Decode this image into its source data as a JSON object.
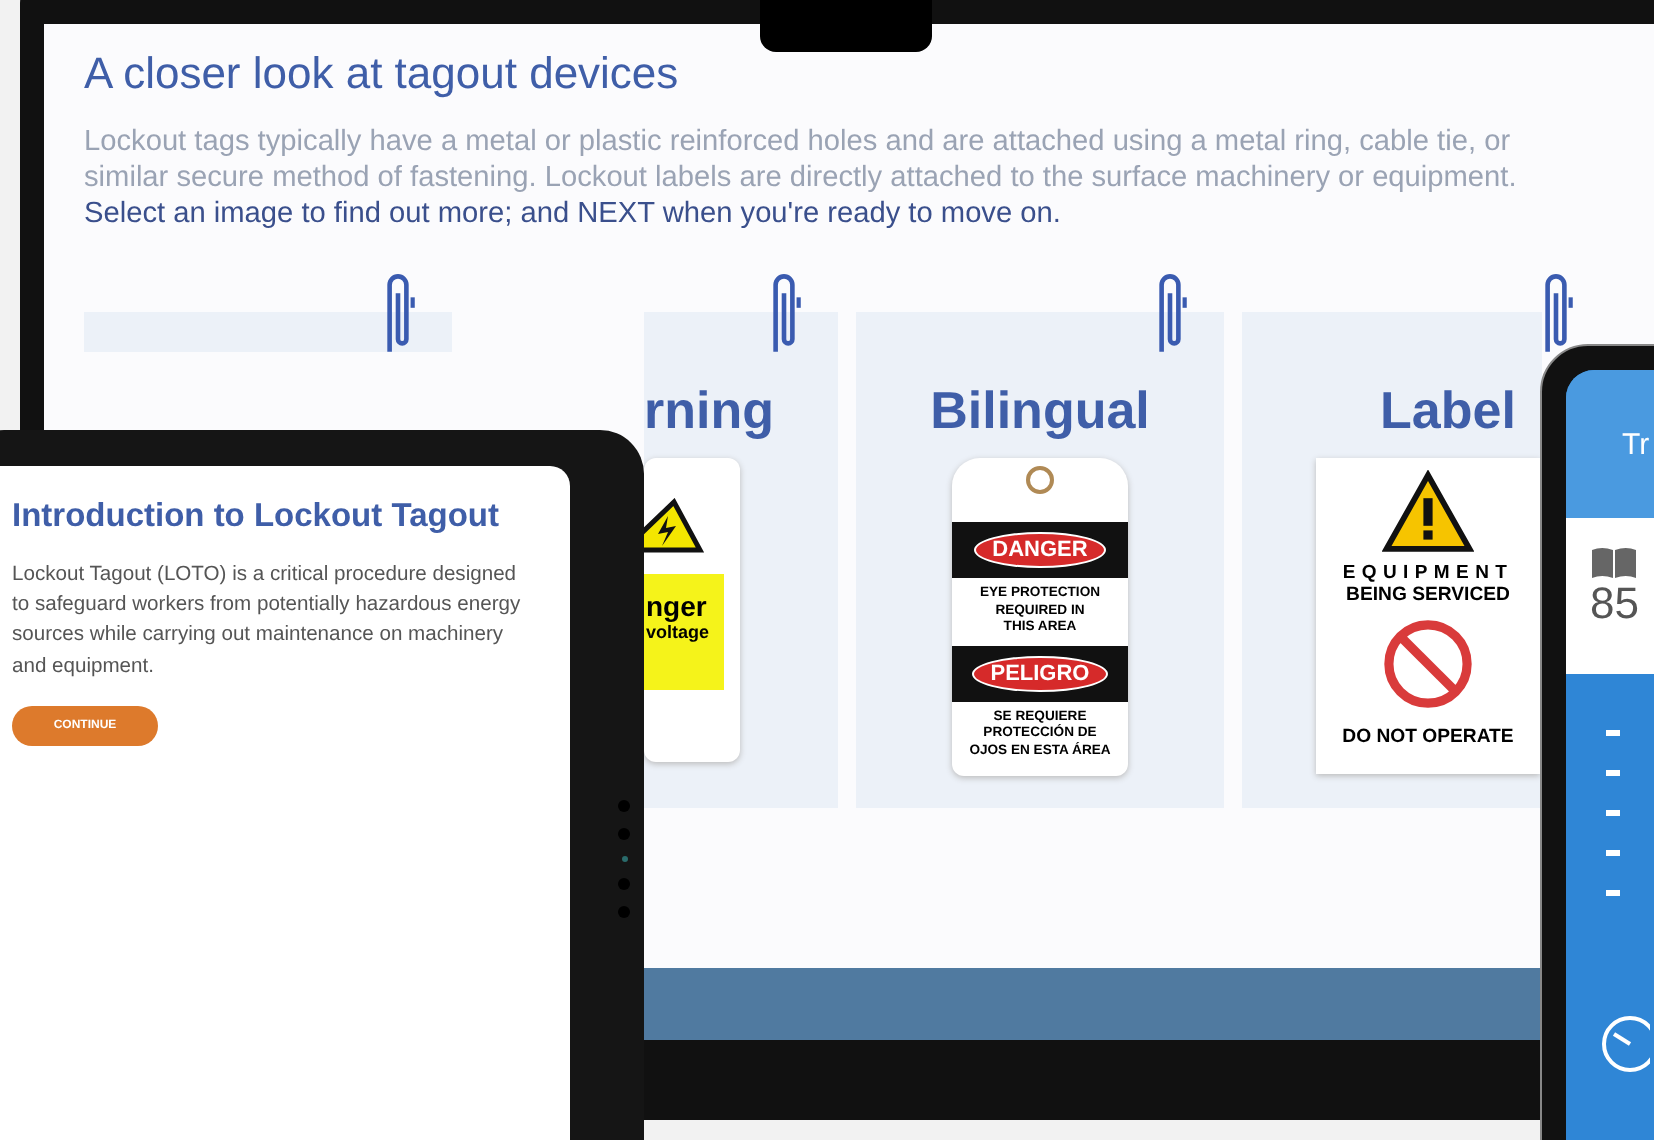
{
  "laptop": {
    "heading": "A closer look at tagout devices",
    "intro": "Lockout tags typically have a metal or plastic reinforced holes and are attached using a metal ring, cable tie, or similar secure method of fastening. Lockout labels are directly attached to the surface machinery or equipment. **Select an image to find out more; and NEXT when you're ready to move on.**",
    "cards": [
      {
        "kind": "blank"
      },
      {
        "kind": "warning-tag",
        "title": "rning",
        "lines": [
          "nger",
          "voltage"
        ]
      },
      {
        "kind": "danger-tag",
        "title": "Bilingual",
        "sections": [
          {
            "header": "DANGER",
            "text": "EYE PROTECTION\nREQUIRED IN\nTHIS AREA"
          },
          {
            "header": "PELIGRO",
            "text": "SE REQUIERE\nPROTECCIÓN DE\nOJOS EN ESTA ÁREA"
          }
        ]
      },
      {
        "kind": "label",
        "title": "Label",
        "top": "EQUIPMENT",
        "middle": "BEING SERVICED",
        "bottom": "DO NOT OPERATE"
      }
    ]
  },
  "tablet": {
    "title": "Introduction to Lockout Tagout",
    "body": "Lockout Tagout (LOTO) is a critical procedure designed to safeguard workers from potentially hazardous energy sources while carrying out maintenance on machinery and equipment.",
    "button": "CONTINUE"
  },
  "phone": {
    "header": "Tr",
    "stat": "85"
  }
}
